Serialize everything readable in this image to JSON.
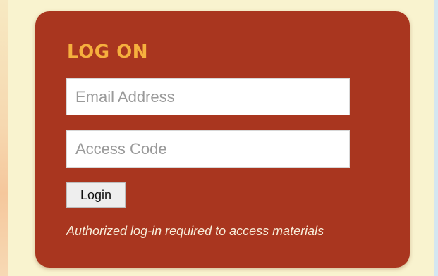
{
  "login": {
    "title": "LOG ON",
    "email_placeholder": "Email Address",
    "email_value": "",
    "code_placeholder": "Access Code",
    "code_value": "",
    "login_label": "Login",
    "note": "Authorized log-in required to access materials"
  },
  "colors": {
    "page_background": "#f9f3cf",
    "panel_background": "#a9361f",
    "title": "#f6b03e",
    "note_text": "#f7ecd8"
  }
}
